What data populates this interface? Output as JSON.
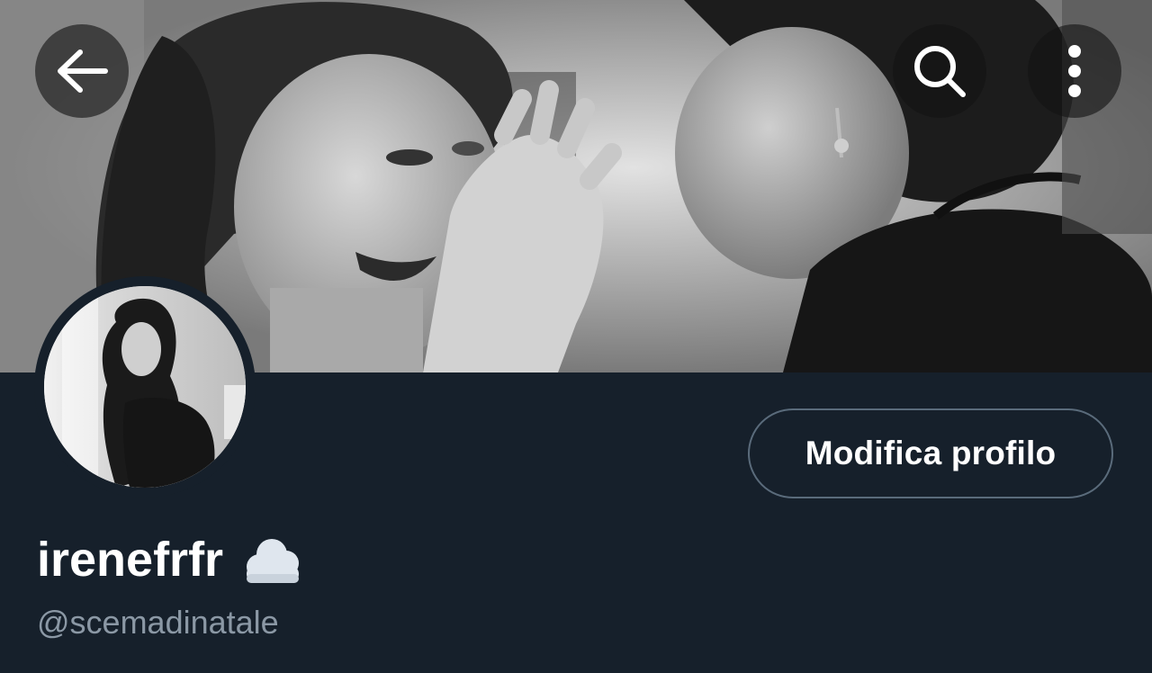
{
  "header": {
    "back_icon": "arrow-left-icon",
    "search_icon": "search-icon",
    "more_icon": "more-vertical-icon",
    "button_background": "#141414"
  },
  "banner": {
    "description_icon": "banner-photo",
    "tone": "grayscale"
  },
  "avatar": {
    "icon": "avatar-photo",
    "tone": "grayscale"
  },
  "profile": {
    "edit_button_label": "Modifica profilo",
    "display_name": "irenefrfr",
    "name_emoji_icon": "cloud-icon",
    "handle": "@scemadinatale"
  },
  "colors": {
    "background": "#16202b",
    "text_primary": "#ffffff",
    "text_secondary": "#8b98a5",
    "button_border": "#5a6b7b"
  }
}
